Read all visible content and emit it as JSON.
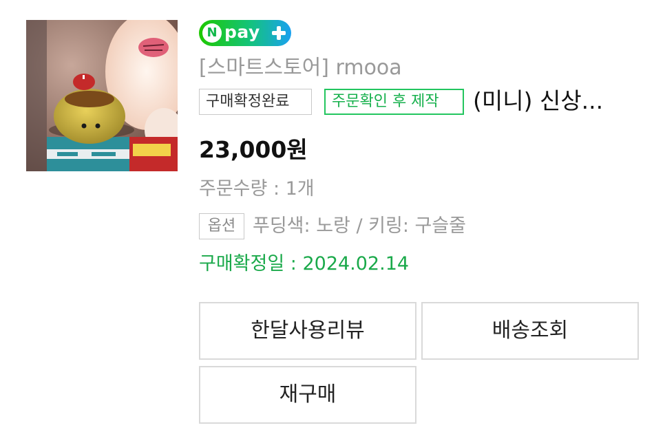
{
  "order": {
    "badge": {
      "n_letter": "N",
      "word": "pay"
    },
    "store_name": "[스마트스토어] rmooa",
    "tags": {
      "status": "구매확정완료",
      "made_to_order": "주문확인 후 제작"
    },
    "product_name": "(미니) 신상...",
    "price": "23,000원",
    "quantity": "주문수량 : 1개",
    "option_tag": "옵션",
    "option_value": "푸딩색: 노랑 / 키링: 구슬줄",
    "confirm_date": "구매확정일 : 2024.02.14"
  },
  "actions": {
    "review": "한달사용리뷰",
    "delivery": "배송조회",
    "rebuy": "재구매"
  },
  "colors": {
    "accent_green": "#1aa94a",
    "tag_green_border": "#22c55e",
    "muted_text": "#999999",
    "border_gray": "#d9d9d9"
  },
  "icons": {
    "badge": "npay-plus-logo",
    "thumbnail": "product-photo-pudding-plush-keyring"
  }
}
